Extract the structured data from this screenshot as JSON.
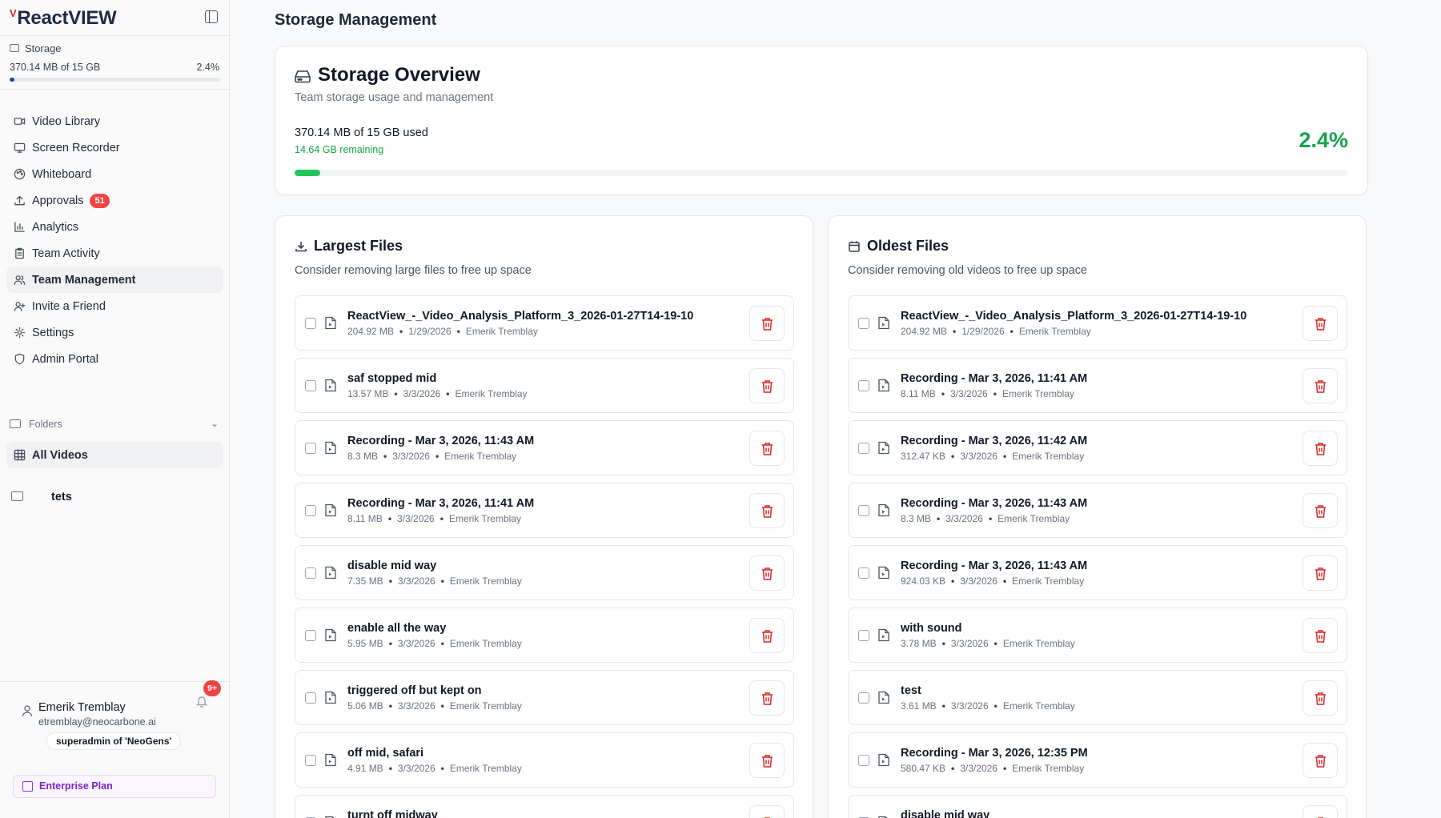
{
  "app": {
    "brand_mark": "V",
    "brand_name": "ReactVIEW"
  },
  "sidebar": {
    "storage": {
      "label": "Storage",
      "used_text": "370.14 MB of 15 GB",
      "percent_text": "2.4%",
      "percent": 2.4
    },
    "nav": [
      {
        "label": "Video Library",
        "icon": "video-icon"
      },
      {
        "label": "Screen Recorder",
        "icon": "monitor-icon"
      },
      {
        "label": "Whiteboard",
        "icon": "palette-icon"
      },
      {
        "label": "Approvals",
        "icon": "upload-icon",
        "badge": "51"
      },
      {
        "label": "Analytics",
        "icon": "bar-chart-icon"
      },
      {
        "label": "Team Activity",
        "icon": "clipboard-icon"
      },
      {
        "label": "Team Management",
        "icon": "users-icon",
        "active": true
      },
      {
        "label": "Invite a Friend",
        "icon": "user-plus-icon"
      },
      {
        "label": "Settings",
        "icon": "gear-icon"
      },
      {
        "label": "Admin Portal",
        "icon": "shield-icon"
      }
    ],
    "folders_label": "Folders",
    "all_videos_label": "All Videos",
    "folder_items": [
      {
        "name": "tets"
      }
    ],
    "user": {
      "name": "Emerik Tremblay",
      "email": "etremblay@neocarbone.ai",
      "role": "superadmin of 'NeoGens'",
      "notification_badge": "9+"
    },
    "plan_label": "Enterprise Plan"
  },
  "main": {
    "page_title": "Storage Management",
    "overview": {
      "title": "Storage Overview",
      "subtitle": "Team storage usage and management",
      "used_text": "370.14 MB of 15 GB used",
      "remaining_text": "14.64 GB remaining",
      "percent_text": "2.4%",
      "percent": 2.4
    },
    "largest": {
      "title": "Largest Files",
      "subtitle": "Consider removing large files to free up space",
      "files": [
        {
          "name": "ReactView_-_Video_Analysis_Platform_3_2026-01-27T14-19-10",
          "size": "204.92 MB",
          "date": "1/29/2026",
          "owner": "Emerik Tremblay"
        },
        {
          "name": "saf stopped mid",
          "size": "13.57 MB",
          "date": "3/3/2026",
          "owner": "Emerik Tremblay"
        },
        {
          "name": "Recording - Mar 3, 2026, 11:43 AM",
          "size": "8.3 MB",
          "date": "3/3/2026",
          "owner": "Emerik Tremblay"
        },
        {
          "name": "Recording - Mar 3, 2026, 11:41 AM",
          "size": "8.11 MB",
          "date": "3/3/2026",
          "owner": "Emerik Tremblay"
        },
        {
          "name": "disable mid way",
          "size": "7.35 MB",
          "date": "3/3/2026",
          "owner": "Emerik Tremblay"
        },
        {
          "name": "enable all the way",
          "size": "5.95 MB",
          "date": "3/3/2026",
          "owner": "Emerik Tremblay"
        },
        {
          "name": "triggered off but kept on",
          "size": "5.06 MB",
          "date": "3/3/2026",
          "owner": "Emerik Tremblay"
        },
        {
          "name": "off mid, safari",
          "size": "4.91 MB",
          "date": "3/3/2026",
          "owner": "Emerik Tremblay"
        },
        {
          "name": "turnt off midway",
          "size": "",
          "date": "",
          "owner": ""
        }
      ]
    },
    "oldest": {
      "title": "Oldest Files",
      "subtitle": "Consider removing old videos to free up space",
      "files": [
        {
          "name": "ReactView_-_Video_Analysis_Platform_3_2026-01-27T14-19-10",
          "size": "204.92 MB",
          "date": "1/29/2026",
          "owner": "Emerik Tremblay"
        },
        {
          "name": "Recording - Mar 3, 2026, 11:41 AM",
          "size": "8.11 MB",
          "date": "3/3/2026",
          "owner": "Emerik Tremblay"
        },
        {
          "name": "Recording - Mar 3, 2026, 11:42 AM",
          "size": "312.47 KB",
          "date": "3/3/2026",
          "owner": "Emerik Tremblay"
        },
        {
          "name": "Recording - Mar 3, 2026, 11:43 AM",
          "size": "8.3 MB",
          "date": "3/3/2026",
          "owner": "Emerik Tremblay"
        },
        {
          "name": "Recording - Mar 3, 2026, 11:43 AM",
          "size": "924.03 KB",
          "date": "3/3/2026",
          "owner": "Emerik Tremblay"
        },
        {
          "name": "with sound",
          "size": "3.78 MB",
          "date": "3/3/2026",
          "owner": "Emerik Tremblay"
        },
        {
          "name": "test",
          "size": "3.61 MB",
          "date": "3/3/2026",
          "owner": "Emerik Tremblay"
        },
        {
          "name": "Recording - Mar 3, 2026, 12:35 PM",
          "size": "580.47 KB",
          "date": "3/3/2026",
          "owner": "Emerik Tremblay"
        },
        {
          "name": "disable mid way",
          "size": "",
          "date": "",
          "owner": ""
        }
      ]
    }
  },
  "colors": {
    "accent_green": "#16a34a",
    "bar_green": "#22c55e",
    "danger": "#dc2626",
    "sidebar_bar": "#1e40af",
    "plan_purple": "#7e22ce"
  }
}
